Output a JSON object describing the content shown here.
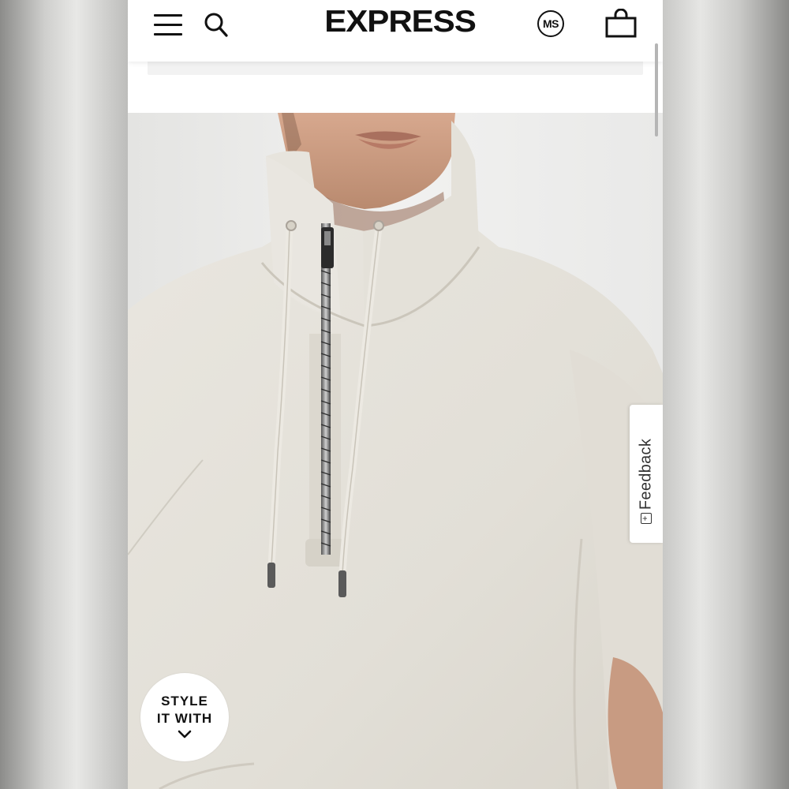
{
  "header": {
    "logo_text": "EXPRESS",
    "account_initials": "MS",
    "icons": [
      "hamburger-menu-icon",
      "search-icon",
      "shopping-bag-icon"
    ]
  },
  "hero": {
    "image_description": "Man wearing oatmeal heather quarter-zip mock neck sweatshirt with drawstrings",
    "style_button": {
      "line1": "STYLE",
      "line2": "IT WITH",
      "icon": "chevron-down-icon"
    }
  },
  "feedback": {
    "label": "Feedback",
    "icon": "feedback-plus-icon"
  },
  "colors": {
    "brand_text": "#111111",
    "header_bg": "#ffffff",
    "sweater": "#e6e3dc"
  }
}
